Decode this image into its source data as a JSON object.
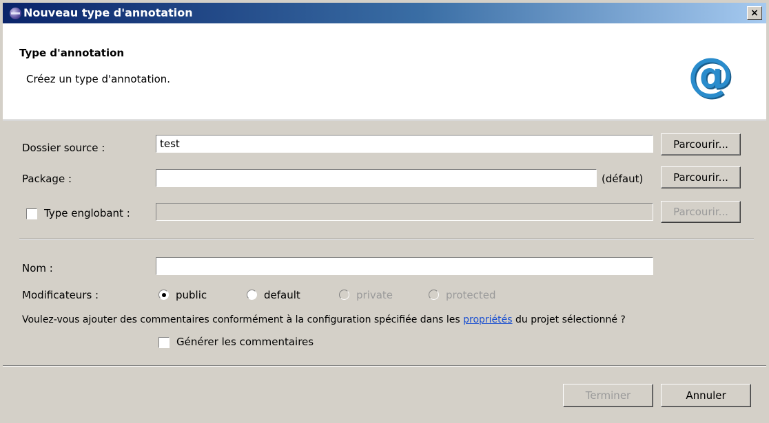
{
  "window": {
    "title": "Nouveau type d'annotation",
    "close_glyph": "×"
  },
  "header": {
    "title": "Type d'annotation",
    "description": "Créez un type d'annotation.",
    "logo_glyph": "@",
    "logo_color": "#2a8ccc"
  },
  "form": {
    "source_folder": {
      "label": "Dossier source :",
      "value": "test",
      "browse": "Parcourir..."
    },
    "package": {
      "label": "Package :",
      "value": "",
      "default_hint": "(défaut)",
      "browse": "Parcourir..."
    },
    "enclosing_type": {
      "label": "Type englobant :",
      "checked": false,
      "value": "",
      "browse": "Parcourir..."
    },
    "name": {
      "label": "Nom :",
      "value": ""
    },
    "modifiers": {
      "label": "Modificateurs :",
      "options": [
        {
          "label": "public",
          "selected": true,
          "enabled": true
        },
        {
          "label": "default",
          "selected": false,
          "enabled": true
        },
        {
          "label": "private",
          "selected": false,
          "enabled": false
        },
        {
          "label": "protected",
          "selected": false,
          "enabled": false
        }
      ]
    },
    "comments": {
      "question_before": "Voulez-vous ajouter des commentaires conformément à la configuration spécifiée dans les ",
      "link_text": "propriétés",
      "question_after": " du projet sélectionné ?",
      "generate_label": "Générer les commentaires",
      "generate_checked": false
    }
  },
  "footer": {
    "finish": "Terminer",
    "cancel": "Annuler"
  }
}
